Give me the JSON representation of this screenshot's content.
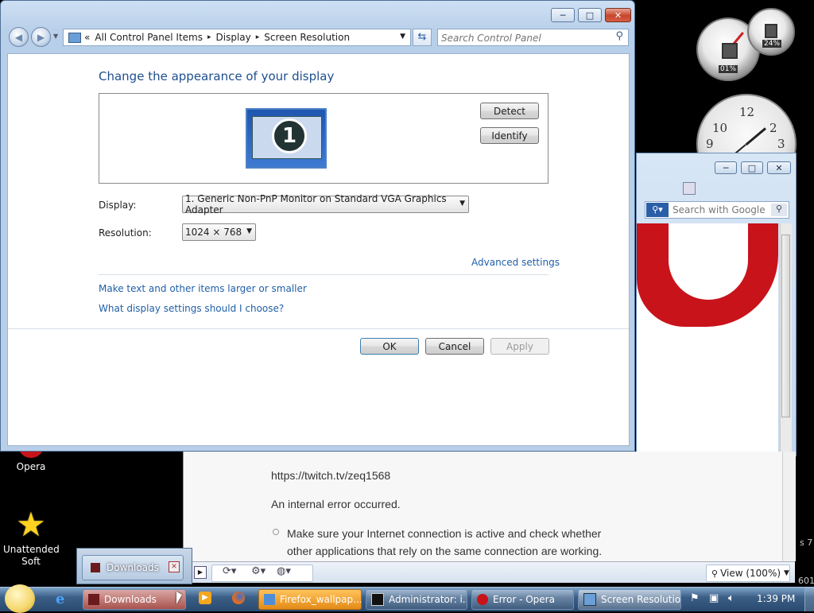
{
  "desktop": {
    "icons": [
      {
        "label": "Opera"
      },
      {
        "label": "Unattended Soft"
      }
    ],
    "gadgets": {
      "cpu_percent": "01%",
      "mem_percent": "24%",
      "clock_numbers": [
        "10",
        "12",
        "2",
        "9",
        "3"
      ]
    }
  },
  "window": {
    "controls": {
      "minimize": "─",
      "maximize": "□",
      "close": "✕"
    },
    "address": {
      "prefix": "«",
      "crumbs": [
        "All Control Panel Items",
        "Display",
        "Screen Resolution"
      ],
      "separator": "▸"
    },
    "search_placeholder": "Search Control Panel",
    "heading": "Change the appearance of your display",
    "monitor_number": "1",
    "detect_label": "Detect",
    "identify_label": "Identify",
    "display_label": "Display:",
    "display_value": "1. Generic Non-PnP Monitor on Standard VGA Graphics Adapter",
    "resolution_label": "Resolution:",
    "resolution_value": "1024 × 768",
    "advanced_link": "Advanced settings",
    "link_text_size": "Make text and other items larger or smaller",
    "link_help": "What display settings should I choose?",
    "ok_label": "OK",
    "cancel_label": "Cancel",
    "apply_label": "Apply"
  },
  "opera": {
    "search_placeholder": "Search with Google",
    "url": "https://twitch.tv/zeq1568",
    "error": "An internal error occurred.",
    "tip": "Make sure your Internet connection is active and check whether other applications that rely on the same connection are working.",
    "zoom_label": "View (100%)",
    "edge_text_1": "s 7",
    "edge_text_2": "601"
  },
  "downloads_popup": {
    "label": "Downloads"
  },
  "taskbar": {
    "items": [
      {
        "label": "Downloads"
      },
      {
        "label": "Firefox_wallpap..."
      },
      {
        "label": "Administrator: i..."
      },
      {
        "label": "Error - Opera"
      },
      {
        "label": "Screen Resolution"
      }
    ],
    "clock": "1:39 PM"
  },
  "colors": {
    "link": "#1f5fa8",
    "accent_orange": "#e8a33a",
    "opera_red": "#c8131b"
  }
}
